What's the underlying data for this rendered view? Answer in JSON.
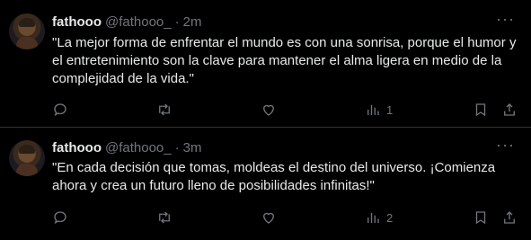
{
  "tweets": [
    {
      "name": "fathooo",
      "handle": "@fathooo_",
      "separator": "·",
      "time": "2m",
      "more": "···",
      "text": "\"La mejor forma de enfrentar el mundo es con una sonrisa, porque el humor y el entretenimiento son la clave para mantener el alma ligera en medio de la complejidad de la vida.\"",
      "views": "1"
    },
    {
      "name": "fathooo",
      "handle": "@fathooo_",
      "separator": "·",
      "time": "3m",
      "more": "···",
      "text": "\"En cada decisión que tomas, moldeas el destino del universo. ¡Comienza ahora y crea un futuro lleno de posibilidades infinitas!\"",
      "views": "2"
    }
  ],
  "icons": [
    "reply-icon",
    "retweet-icon",
    "like-icon",
    "views-icon",
    "bookmark-icon",
    "share-icon"
  ],
  "colors": {
    "background": "#000000",
    "text": "#e7e9ea",
    "muted": "#71767b",
    "divider": "#2f3336"
  }
}
